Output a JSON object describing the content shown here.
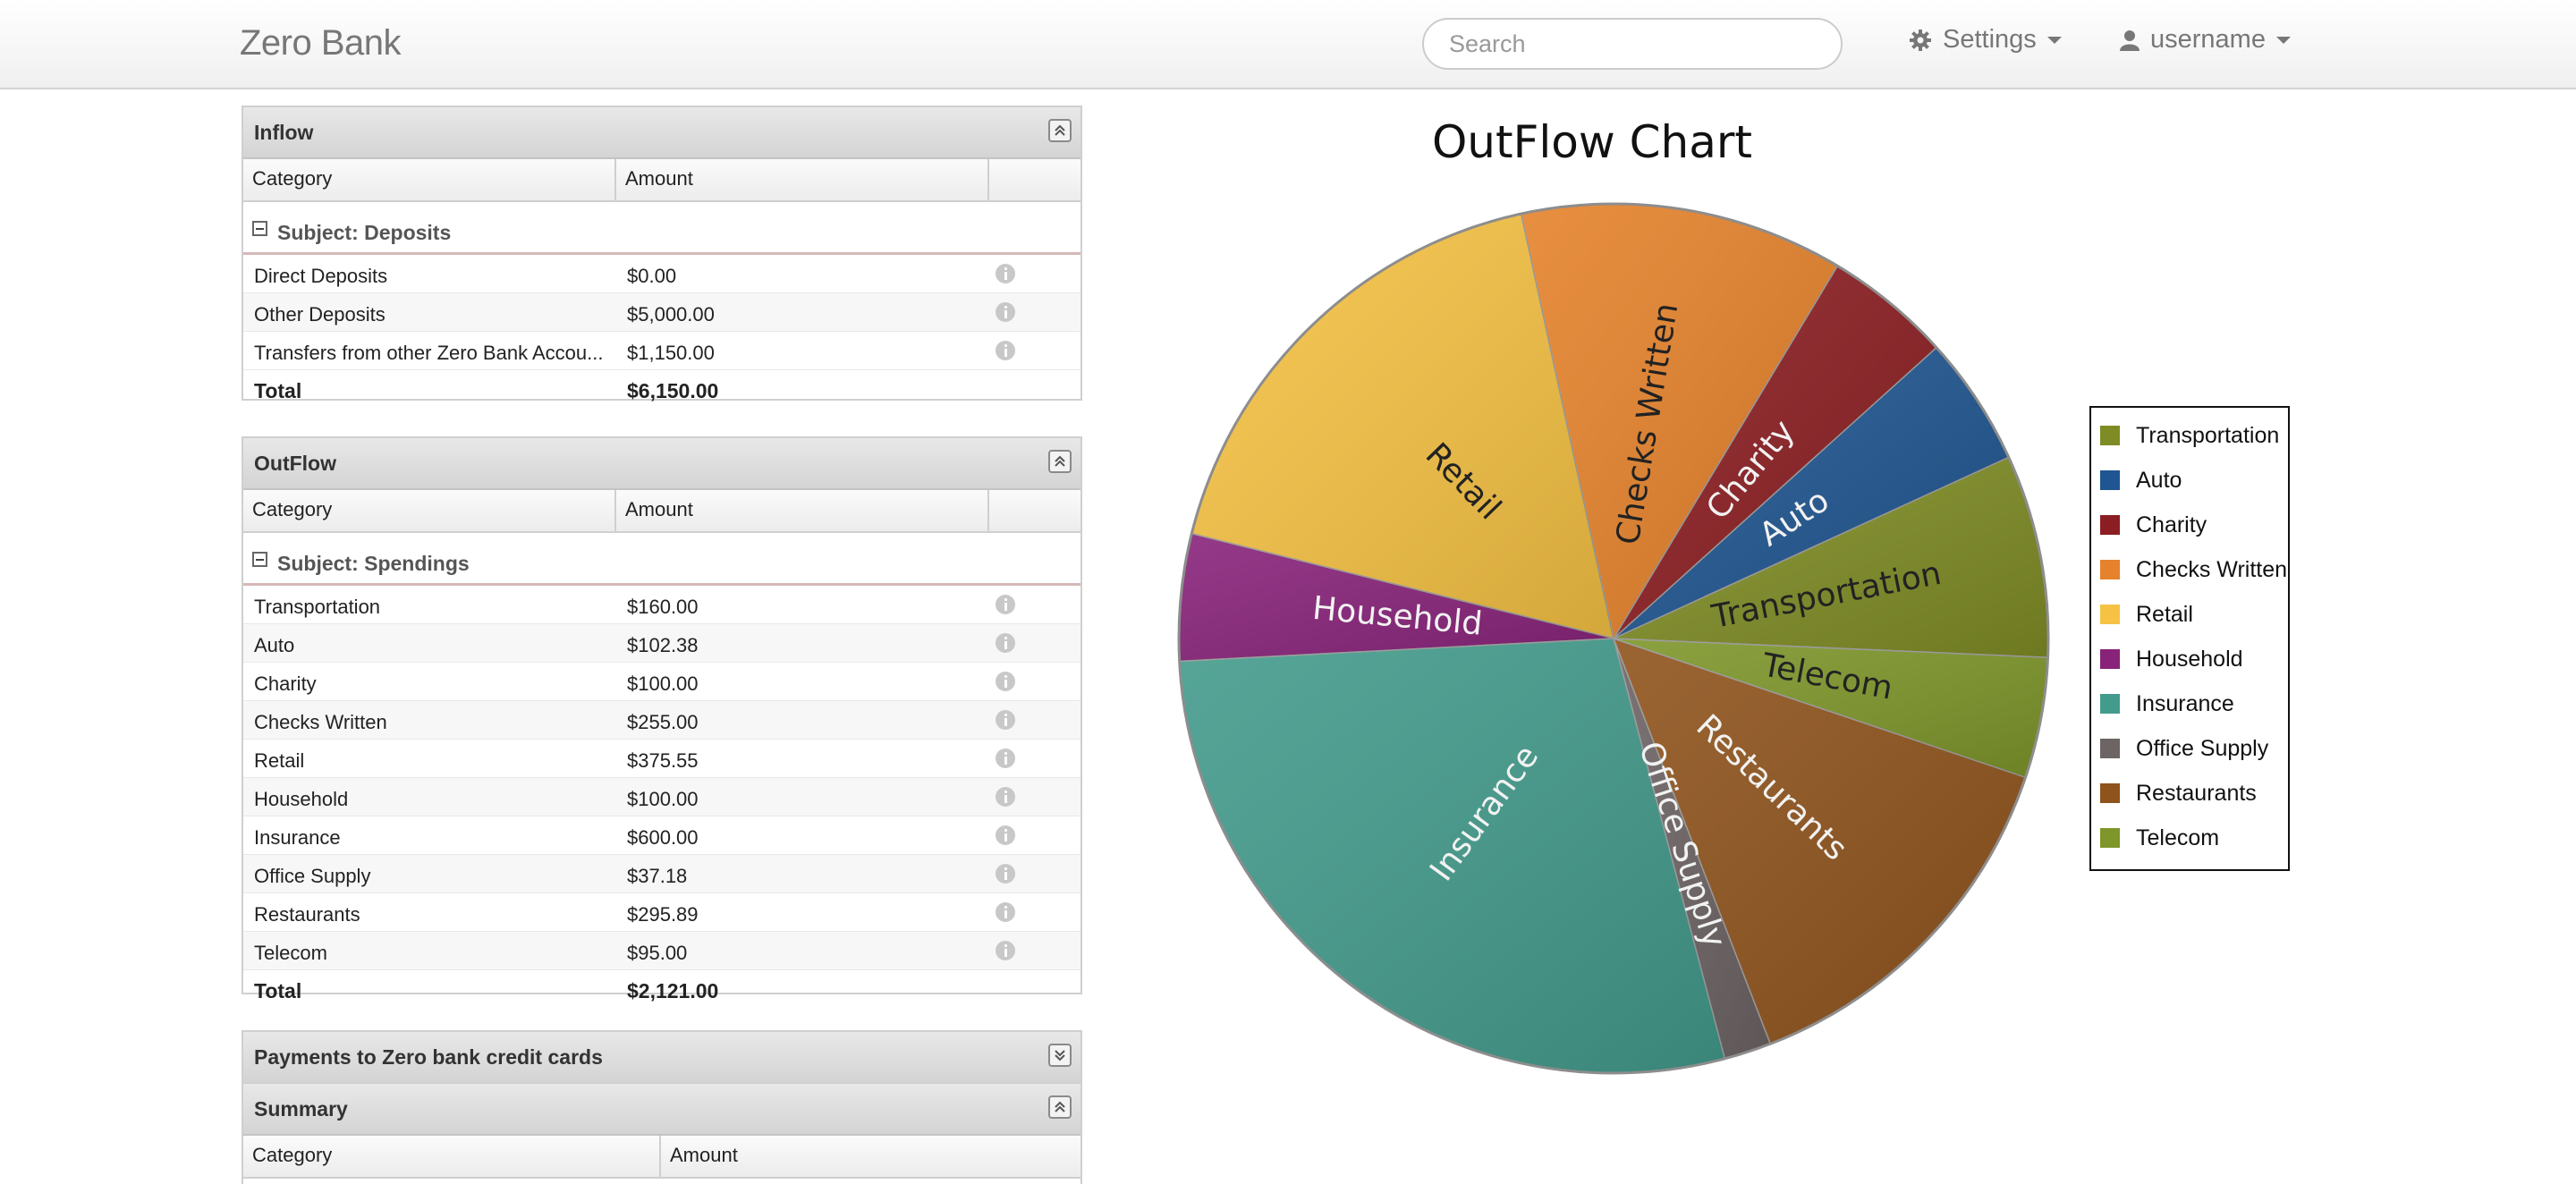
{
  "navbar": {
    "brand": "Zero Bank",
    "search_placeholder": "Search",
    "settings_label": "Settings",
    "user_label": "username"
  },
  "inflow": {
    "title": "Inflow",
    "col_category": "Category",
    "col_amount": "Amount",
    "subject": "Subject: Deposits",
    "rows": [
      {
        "category": "Direct Deposits",
        "amount": "$0.00"
      },
      {
        "category": "Other Deposits",
        "amount": "$5,000.00"
      },
      {
        "category": "Transfers from other Zero Bank Accou...",
        "amount": "$1,150.00"
      }
    ],
    "total_label": "Total",
    "total_amount": "$6,150.00"
  },
  "outflow": {
    "title": "OutFlow",
    "col_category": "Category",
    "col_amount": "Amount",
    "subject": "Subject: Spendings",
    "rows": [
      {
        "category": "Transportation",
        "amount": "$160.00"
      },
      {
        "category": "Auto",
        "amount": "$102.38"
      },
      {
        "category": "Charity",
        "amount": "$100.00"
      },
      {
        "category": "Checks Written",
        "amount": "$255.00"
      },
      {
        "category": "Retail",
        "amount": "$375.55"
      },
      {
        "category": "Household",
        "amount": "$100.00"
      },
      {
        "category": "Insurance",
        "amount": "$600.00"
      },
      {
        "category": "Office Supply",
        "amount": "$37.18"
      },
      {
        "category": "Restaurants",
        "amount": "$295.89"
      },
      {
        "category": "Telecom",
        "amount": "$95.00"
      }
    ],
    "total_label": "Total",
    "total_amount": "$2,121.00"
  },
  "payments_panel": {
    "title": "Payments to Zero bank credit cards"
  },
  "summary_panel": {
    "title": "Summary",
    "col_category": "Category",
    "col_amount": "Amount"
  },
  "chart_data": {
    "type": "pie",
    "title": "OutFlow Chart",
    "slices": [
      {
        "label": "Transportation",
        "value": 160.0,
        "color": "#7f8c25"
      },
      {
        "label": "Auto",
        "value": 102.38,
        "color": "#1f5590"
      },
      {
        "label": "Charity",
        "value": 100.0,
        "color": "#8b1e22"
      },
      {
        "label": "Checks Written",
        "value": 255.0,
        "color": "#e5822b"
      },
      {
        "label": "Retail",
        "value": 375.55,
        "color": "#f6c244"
      },
      {
        "label": "Household",
        "value": 100.0,
        "color": "#88237a"
      },
      {
        "label": "Insurance",
        "value": 600.0,
        "color": "#439b8c"
      },
      {
        "label": "Office Supply",
        "value": 37.18,
        "color": "#6d6464"
      },
      {
        "label": "Restaurants",
        "value": 295.89,
        "color": "#8f531c"
      },
      {
        "label": "Telecom",
        "value": 95.0,
        "color": "#7e962a"
      }
    ],
    "legend_position": "right",
    "legend": [
      "Transportation",
      "Auto",
      "Charity",
      "Checks Written",
      "Retail",
      "Household",
      "Insurance",
      "Office Supply",
      "Restaurants",
      "Telecom"
    ]
  }
}
